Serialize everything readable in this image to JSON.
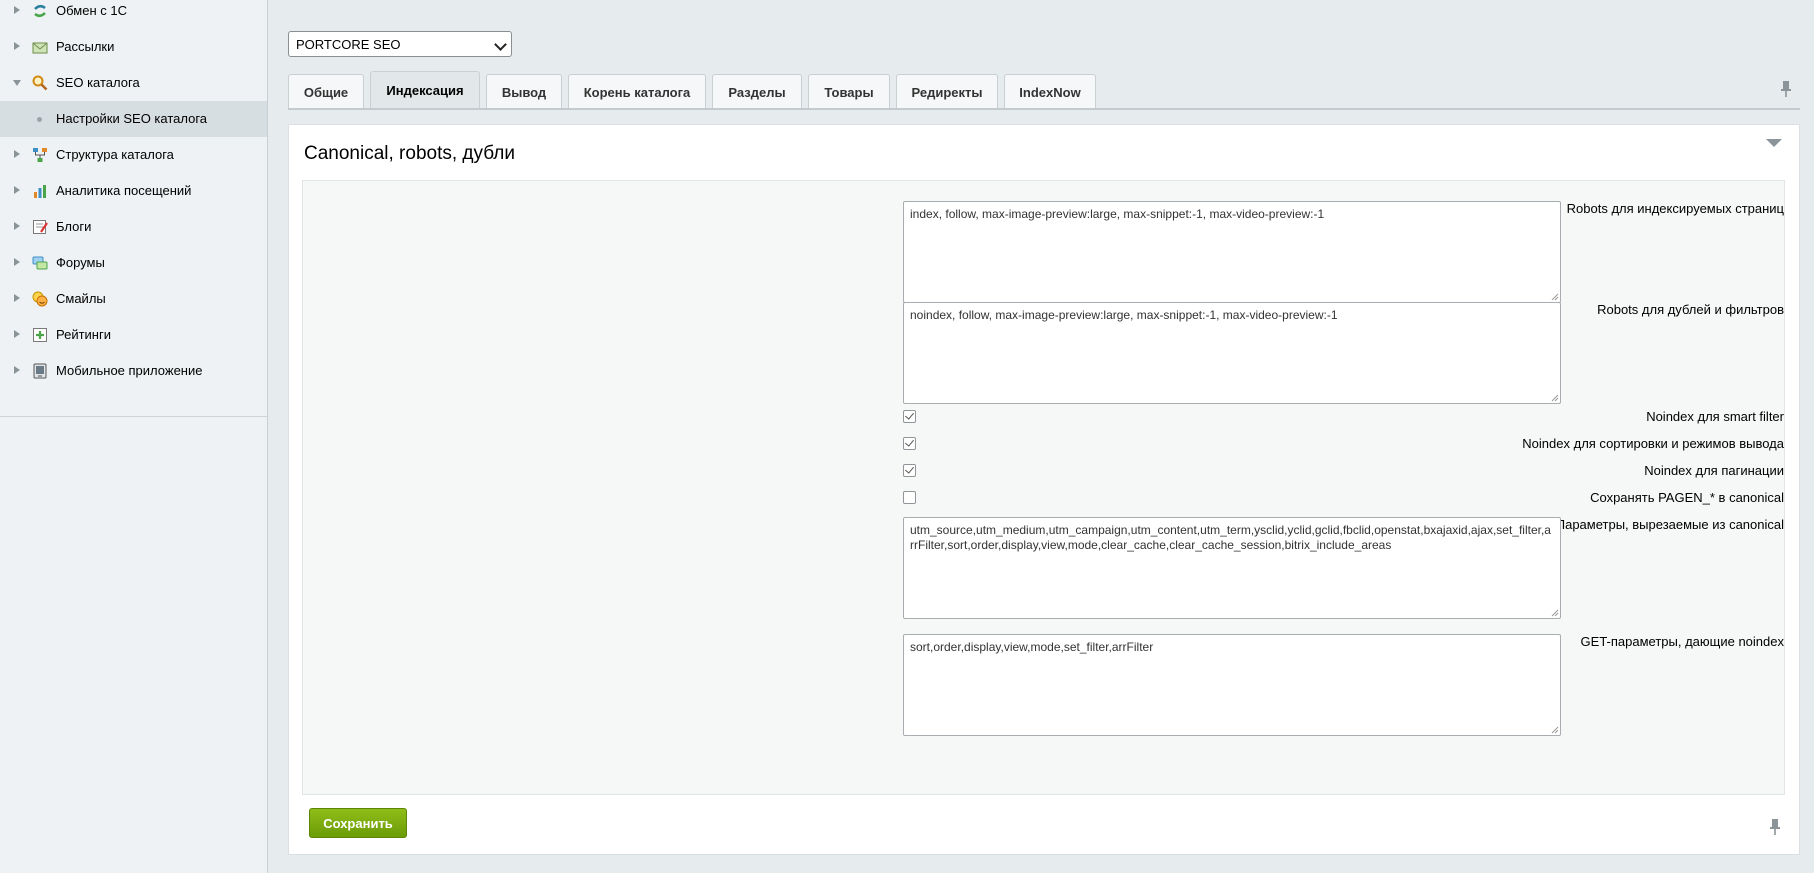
{
  "sidebar": {
    "items": [
      {
        "label": "Обмен с 1С",
        "icon": "exchange-icon",
        "expanded": false
      },
      {
        "label": "Рассылки",
        "icon": "mail-icon",
        "expanded": false
      },
      {
        "label": "SEO каталога",
        "icon": "seo-search-icon",
        "expanded": true
      },
      {
        "label": "Настройки SEO каталога",
        "selected": true
      },
      {
        "label": "Структура каталога",
        "icon": "structure-icon",
        "expanded": false
      },
      {
        "label": "Аналитика посещений",
        "icon": "analytics-icon",
        "expanded": false
      },
      {
        "label": "Блоги",
        "icon": "blog-icon",
        "expanded": false
      },
      {
        "label": "Форумы",
        "icon": "forum-icon",
        "expanded": false
      },
      {
        "label": "Смайлы",
        "icon": "smile-icon",
        "expanded": false
      },
      {
        "label": "Рейтинги",
        "icon": "rating-icon",
        "expanded": false
      },
      {
        "label": "Мобильное приложение",
        "icon": "mobile-app-icon",
        "expanded": false
      }
    ]
  },
  "site_select": {
    "value": "PORTCORE SEO"
  },
  "tabs": [
    {
      "label": "Общие",
      "active": false
    },
    {
      "label": "Индексация",
      "active": true
    },
    {
      "label": "Вывод",
      "active": false
    },
    {
      "label": "Корень каталога",
      "active": false
    },
    {
      "label": "Разделы",
      "active": false
    },
    {
      "label": "Товары",
      "active": false
    },
    {
      "label": "Редиректы",
      "active": false
    },
    {
      "label": "IndexNow",
      "active": false
    }
  ],
  "section": {
    "title": "Canonical, robots, дубли"
  },
  "fields": {
    "robots_index": {
      "label": "Robots для индексируемых страниц",
      "value": "index, follow, max-image-preview:large, max-snippet:-1, max-video-preview:-1"
    },
    "robots_dupes": {
      "label": "Robots для дублей и фильтров",
      "value": "noindex, follow, max-image-preview:large, max-snippet:-1, max-video-preview:-1"
    },
    "noindex_smart": {
      "label": "Noindex для smart filter",
      "checked": true
    },
    "noindex_sort": {
      "label": "Noindex для сортировки и режимов вывода",
      "checked": true
    },
    "noindex_pagination": {
      "label": "Noindex для пагинации",
      "checked": true
    },
    "keep_pagen": {
      "label": "Сохранять PAGEN_* в canonical",
      "checked": false
    },
    "canonical_params": {
      "label": "Параметры, вырезаемые из canonical",
      "value": "utm_source,utm_medium,utm_campaign,utm_content,utm_term,ysclid,yclid,gclid,fbclid,openstat,bxajaxid,ajax,set_filter,arrFilter,sort,order,display,view,mode,clear_cache,clear_cache_session,bitrix_include_areas"
    },
    "noindex_get": {
      "label": "GET-параметры, дающие noindex",
      "value": "sort,order,display,view,mode,set_filter,arrFilter"
    }
  },
  "buttons": {
    "save": "Сохранить"
  },
  "colors": {
    "save_button": "#7aab0f",
    "page_bg": "#e6ebee",
    "sidebar_bg": "#eef2f4"
  }
}
